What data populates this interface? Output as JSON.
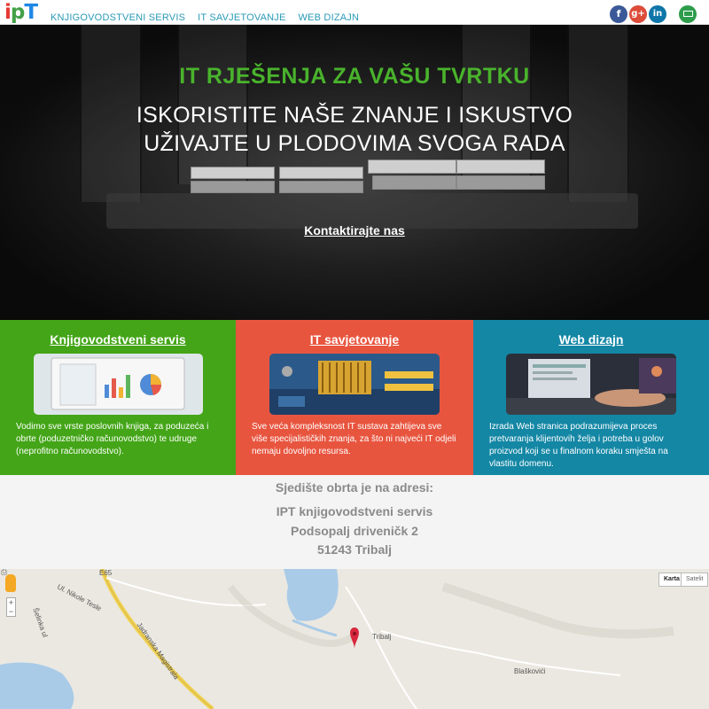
{
  "nav": {
    "logo": {
      "i": "i",
      "p": "p",
      "t": "T"
    },
    "links": [
      "KNJIGOVODSTVENI SERVIS",
      "IT SAVJETOVANJE",
      "WEB DIZAJN"
    ],
    "social": {
      "facebook": "f",
      "google": "g+",
      "linkedin": "in"
    }
  },
  "hero": {
    "title": "IT RJEŠENJA ZA VAŠU TVRTKU",
    "line1": "ISKORISTITE NAŠE ZNANJE I ISKUSTVO",
    "line2": "UŽIVAJTE U PLODOVIMA SVOGA RADA",
    "cta": "Kontaktirajte nas"
  },
  "services": [
    {
      "title": "Knjigovodstveni servis",
      "text": "Vodimo sve vrste poslovnih knjiga, za poduzeća i obrte (poduzetničko računovodstvo) te udruge (neprofitno računovodstvo).",
      "color": "#43a517"
    },
    {
      "title": "IT savjetovanje",
      "text": "Sve veća kompleksnost IT sustava zahtijeva sve više specijalističkih znanja, za što ni najveći IT odjeli nemaju dovoljno resursa.",
      "color": "#e8553f"
    },
    {
      "title": "Web dizajn",
      "text": "Izrada Web stranica podrazumijeva proces pretvaranja klijentovih želja i potreba u golov proizvod koji se u finalnom koraku smješta na vlastitu domenu.",
      "color": "#1487a5"
    }
  ],
  "address": {
    "heading": "Sjedište obrta je na adresi:",
    "name": "IPT knjigovodstveni servis",
    "street": "Podsopalj driveničk 2",
    "city": "51243 Tribalj"
  },
  "map": {
    "type_karta": "Karta",
    "type_satelit": "Satelit",
    "labels": {
      "tribalj": "Tribalj",
      "blaskovici": "Blaškovići",
      "nikole_tesle": "Ul. Nikole Tesle",
      "magistrala": "Jadranska Magistrala",
      "road_e65": "E65",
      "selo_ul": "Šelinka ul"
    }
  }
}
